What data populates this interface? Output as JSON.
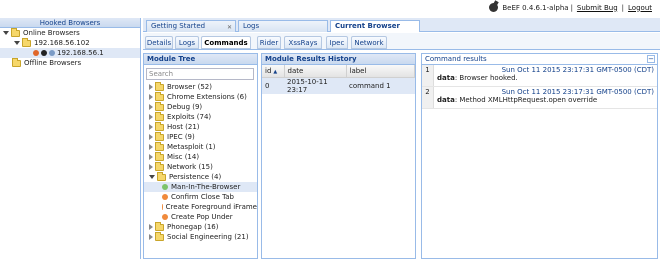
{
  "topbar": {
    "version": "BeEF  0.4.6.1-alpha",
    "submit_bug": "Submit  Bug",
    "logout": "Logout",
    "sep": "|"
  },
  "left": {
    "header": "Hooked Browsers",
    "online": "Online Browsers",
    "subnet": "192.168.56.102",
    "browser_ip": "192.168.56.1",
    "offline": "Offline Browsers"
  },
  "tabs": [
    {
      "label": "Getting Started"
    },
    {
      "label": "Logs"
    },
    {
      "label": "Current Browser"
    }
  ],
  "subtabs": [
    {
      "label": "Details"
    },
    {
      "label": "Logs"
    },
    {
      "label": "Commands"
    },
    {
      "label": "Rider"
    },
    {
      "label": "XssRays"
    },
    {
      "label": "Ipec"
    },
    {
      "label": "Network"
    }
  ],
  "module_tree": {
    "title": "Module Tree",
    "search_placeholder": "Search",
    "items": [
      {
        "label": "Browser (52)"
      },
      {
        "label": "Chrome Extensions (6)"
      },
      {
        "label": "Debug (9)"
      },
      {
        "label": "Exploits (74)"
      },
      {
        "label": "Host (21)"
      },
      {
        "label": "IPEC (9)"
      },
      {
        "label": "Metasploit (1)"
      },
      {
        "label": "Misc (14)"
      },
      {
        "label": "Network (15)"
      },
      {
        "label": "Persistence (4)"
      },
      {
        "label": "Man-In-The-Browser"
      },
      {
        "label": "Confirm Close Tab"
      },
      {
        "label": "Create Foreground iFrame"
      },
      {
        "label": "Create Pop Under"
      },
      {
        "label": "Phonegap (16)"
      },
      {
        "label": "Social Engineering (21)"
      }
    ],
    "colors": {
      "green": "#7cc36b",
      "orange": "#f08a3c"
    }
  },
  "history": {
    "title": "Module Results History",
    "columns": [
      "id",
      "date",
      "label"
    ],
    "rows": [
      {
        "id": "0",
        "date": "2015-10-11 23:17",
        "label": "command 1"
      }
    ]
  },
  "results": {
    "title": "Command results",
    "collapse": "−",
    "entries": [
      {
        "num": "1",
        "time": "Sun Oct 11 2015 23:17:31 GMT-0500 (CDT)",
        "key": "data",
        "value": ": Browser hooked."
      },
      {
        "num": "2",
        "time": "Sun Oct 11 2015 23:17:31 GMT-0500 (CDT)",
        "key": "data",
        "value": ": Method XMLHttpRequest.open override"
      }
    ]
  }
}
